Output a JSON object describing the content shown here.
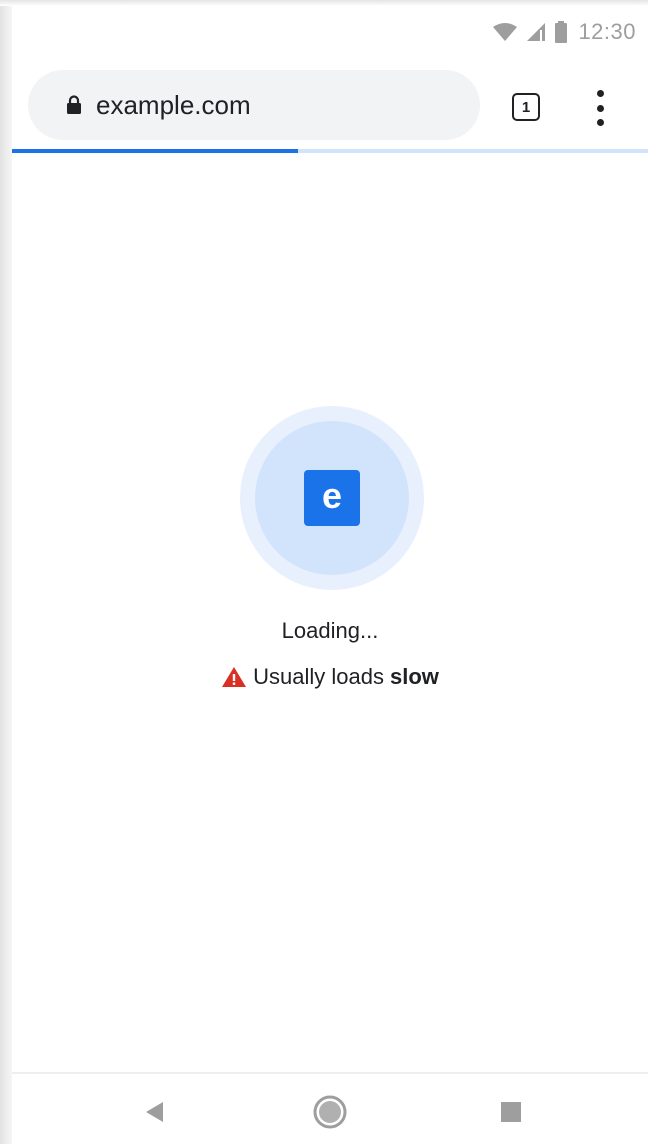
{
  "status_bar": {
    "time": "12:30",
    "icons": [
      "wifi-icon",
      "cell-signal-icon",
      "battery-icon"
    ]
  },
  "toolbar": {
    "url": "example.com",
    "lock_icon": "lock-icon",
    "tab_count": "1",
    "menu_icon": "more-vert-icon"
  },
  "progress": {
    "fraction": 0.45,
    "fill_color": "#1a73e8",
    "track_color": "#d2e3fc"
  },
  "content": {
    "favicon_letter": "e",
    "favicon_color": "#1a73e8",
    "loading_text": "Loading...",
    "warning_prefix": "Usually loads",
    "warning_emphasis": "slow",
    "warning_color": "#d93025"
  },
  "nav_bar": {
    "buttons": [
      "back-icon",
      "home-icon",
      "recents-icon"
    ]
  }
}
